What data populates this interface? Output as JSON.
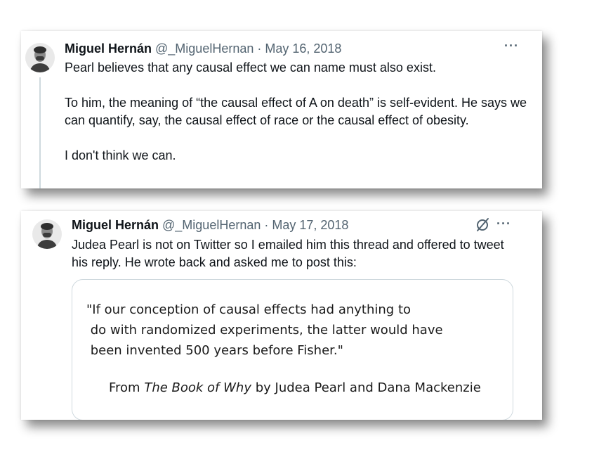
{
  "tweets": [
    {
      "author_name": "Miguel Hernán",
      "handle": "@_MiguelHernan",
      "separator": "·",
      "date": "May 16, 2018",
      "more_icon": "ellipsis-icon",
      "more_label": "···",
      "paragraphs": [
        "Pearl believes that any causal effect we can name must also exist.",
        "To him, the meaning of “the causal effect of A on death” is self-evident. He says we can quantify, say, the causal effect of race or the causal effect of obesity.",
        "I don't think we can."
      ]
    },
    {
      "author_name": "Miguel Hernán",
      "handle": "@_MiguelHernan",
      "separator": "·",
      "date": "May 17, 2018",
      "grok_icon": "grok-slash-circle-icon",
      "more_icon": "ellipsis-icon",
      "more_label": "···",
      "text": "Judea Pearl is not on Twitter so I emailed him this thread and offered to tweet his reply. He wrote back and asked me to post this:",
      "quote": {
        "lines": [
          "\"If our conception of causal effects had anything to",
          " do with randomized experiments, the latter would have",
          " been invented 500 years before Fisher.\""
        ],
        "attribution_prefix": "From ",
        "attribution_title": "The Book of Why",
        "attribution_suffix": " by Judea Pearl and Dana Mackenzie"
      }
    }
  ],
  "colors": {
    "text": "#0f1419",
    "secondary": "#536471",
    "border": "#cfd9de"
  }
}
